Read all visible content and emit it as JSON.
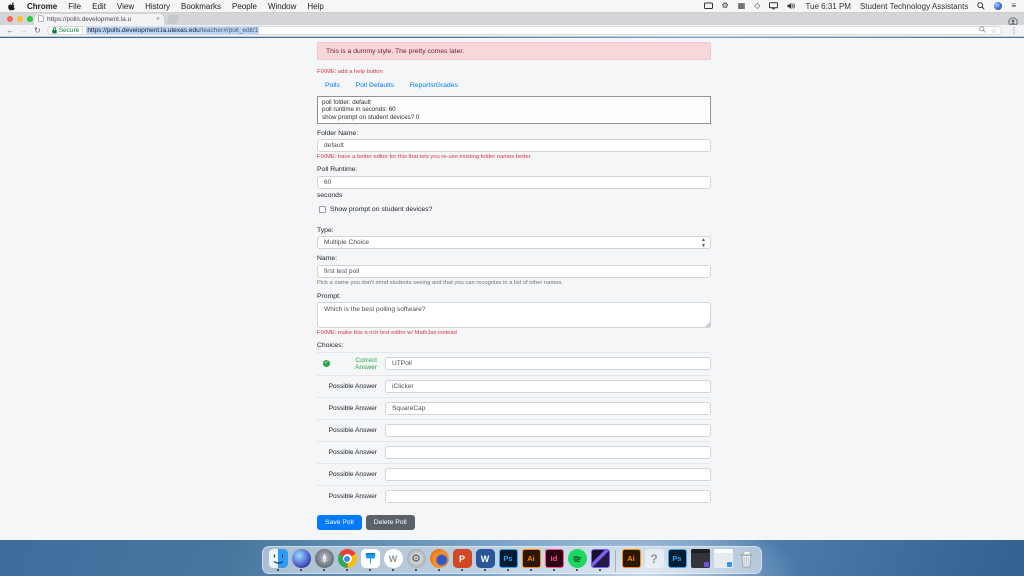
{
  "menu_bar": {
    "app_name": "Chrome",
    "items": [
      "File",
      "Edit",
      "View",
      "History",
      "Bookmarks",
      "People",
      "Window",
      "Help"
    ],
    "status_icons": [
      "display-icon",
      "gear-icon",
      "grid-icon",
      "diamond-icon",
      "monitor-icon",
      "volume-icon"
    ],
    "time": "Tue 6:31 PM",
    "user": "Student Technology Assistants",
    "spotlight_icon": "search-icon",
    "siri_icon": "siri-icon",
    "notification_icon": "notification-center-icon"
  },
  "browser": {
    "tab_title": "https://polls.development.la.u",
    "close_glyph": "×",
    "secure_label": "Secure",
    "url_host": "https://polls.development.la.utexas.edu",
    "url_path": "/teacher#/poll_edit/1",
    "back_glyph": "←",
    "forward_glyph": "→",
    "reload_glyph": "↻",
    "star_glyph": "☆",
    "kebab_glyph": "⋮"
  },
  "page": {
    "alert": "This is a dummy style. The pretty comes later.",
    "fixme_help": "FIXME: add a help button",
    "nav_tabs": [
      "Polls",
      "Poll Defaults",
      "Reports/Grades"
    ],
    "debug_lines": [
      "poll folder: default",
      "poll runtime in seconds: 60",
      "show prompt on student devices? 0"
    ],
    "folder": {
      "label": "Folder Name:",
      "value": "default"
    },
    "fixme_folder": "FIXME: have a better editor for this that lets you re-use existing folder names better",
    "runtime": {
      "label": "Poll Runtime:",
      "value": "60",
      "suffix": "seconds"
    },
    "show_prompt_label": "Show prompt on student devices?",
    "type": {
      "label": "Type:",
      "value": "Multiple Choice"
    },
    "name": {
      "label": "Name:",
      "value": "first test poll",
      "help": "Pick a name you don't mind students seeing and that you can recognize in a list of other names."
    },
    "prompt": {
      "label": "Prompt:",
      "value": "Which is the best polling software?"
    },
    "fixme_prompt": "FIXME: make this a rich text editor w/ MathJax instead",
    "choices_label": "Choices:",
    "choices": [
      {
        "label": "Correct Answer",
        "value": "UTPoll"
      },
      {
        "label": "Possible Answer",
        "value": "iClicker"
      },
      {
        "label": "Possible Answer",
        "value": "SquareCap"
      },
      {
        "label": "Possible Answer",
        "value": ""
      },
      {
        "label": "Possible Answer",
        "value": ""
      },
      {
        "label": "Possible Answer",
        "value": ""
      },
      {
        "label": "Possible Answer",
        "value": ""
      }
    ],
    "save_button": "Save Poll",
    "delete_button": "Delete Poll",
    "check_glyph": "✓"
  },
  "colors": {
    "alert_bg": "#f8d7da",
    "alert_text": "#721c24",
    "fixme_red": "#dc3545",
    "link_blue": "#007bff",
    "correct_green": "#28a745",
    "primary_button": "#007bff",
    "secondary_button": "#5a6268",
    "secure_green": "#0b8043"
  },
  "dock": {
    "items": [
      "finder",
      "siri",
      "launchpad",
      "chrome",
      "keynote",
      "w-app",
      "system-preferences",
      "firefox",
      "powerpoint",
      "word",
      "photoshop",
      "illustrator",
      "indesign",
      "spotify",
      "design-app",
      "illustrator-file",
      "missing-app",
      "photoshop-file",
      "dark-window",
      "light-window",
      "trash"
    ],
    "wapp_letter": "W",
    "gear_glyph": "⚙",
    "ppt_letter": "P",
    "word_letter": "W",
    "ps_label": "Ps",
    "ai_label": "Ai",
    "id_label": "Id",
    "question_glyph": "?"
  }
}
